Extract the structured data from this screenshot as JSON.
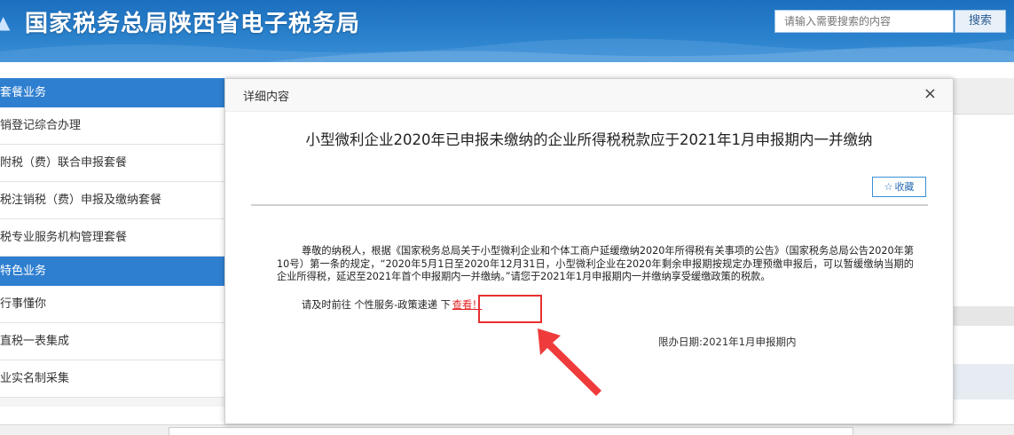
{
  "header": {
    "title": "国家税务总局陕西省电子税务局",
    "search_placeholder": "请输入需要搜索的内容",
    "search_button": "搜索"
  },
  "sidebar": {
    "sections": [
      {
        "label": "套餐业务",
        "items": [
          "销登记综合办理",
          "附税（费）联合申报套餐",
          "税注销税（费）申报及缴纳套餐",
          "税专业服务机构管理套餐"
        ]
      },
      {
        "label": "特色业务",
        "items": [
          "行事懂你",
          "直税一表集成",
          "业实名制采集"
        ]
      }
    ]
  },
  "modal": {
    "header_title": "详细内容",
    "close_glyph": "×",
    "article_title": "小型微利企业2020年已申报未缴纳的企业所得税税款应于2021年1月申报期内一并缴纳",
    "favorite_label": "收藏",
    "body_text": "尊敬的纳税人，根据《国家税务总局关于小型微利企业和个体工商户延缓缴纳2020年所得税有关事项的公告》（国家税务总局公告2020年第10号）第一条的规定，“2020年5月1日至2020年12月31日，小型微利企业在2020年剩余申报期按规定办理预缴申报后，可以暂缓缴纳当期的企业所得税，延迟至2021年首个申报期内一并缴纳。”请您于2021年1月申报期内一并缴纳享受缓缴政策的税款。",
    "guide_text": "请及时前往 个性服务-政策速递 下",
    "view_link": "查看！",
    "deadline": "限办日期:2021年1月申报期内"
  },
  "colors": {
    "header_blue": "#2b82cc",
    "sidebar_section": "#2f7fd0",
    "highlight_red": "#e53030",
    "link_red": "#e02020"
  }
}
